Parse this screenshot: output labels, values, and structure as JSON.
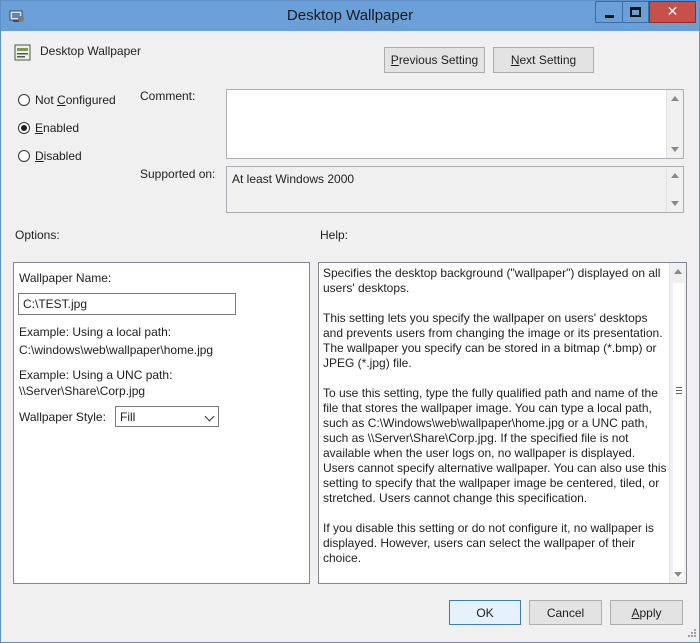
{
  "window": {
    "title": "Desktop Wallpaper",
    "minimize_icon": "minimize-icon",
    "maximize_icon": "maximize-icon",
    "close_icon": "close-icon"
  },
  "header": {
    "policy_name": "Desktop Wallpaper",
    "previous_setting_label": "Previous Setting",
    "previous_setting_mnemonic": "P",
    "next_setting_label": "Next Setting",
    "next_setting_mnemonic": "N"
  },
  "state": {
    "options": [
      {
        "label": "Not Configured",
        "mnemonic": "C",
        "checked": false
      },
      {
        "label": "Enabled",
        "mnemonic": "E",
        "checked": true
      },
      {
        "label": "Disabled",
        "mnemonic": "D",
        "checked": false
      }
    ]
  },
  "comment": {
    "label": "Comment:",
    "value": ""
  },
  "supported": {
    "label": "Supported on:",
    "value": "At least Windows 2000"
  },
  "options_section": {
    "heading": "Options:",
    "wallpaper_name_label": "Wallpaper Name:",
    "wallpaper_name_value": "C:\\TEST.jpg",
    "example_local_label": "Example: Using a local path:",
    "example_local_path": "C:\\windows\\web\\wallpaper\\home.jpg",
    "example_unc_label": "Example: Using a UNC path:",
    "example_unc_path": "\\\\Server\\Share\\Corp.jpg",
    "wallpaper_style_label": "Wallpaper Style:",
    "wallpaper_style_value": "Fill"
  },
  "help_section": {
    "heading": "Help:",
    "paragraphs": [
      "Specifies the desktop background (\"wallpaper\") displayed on all users' desktops.",
      "This setting lets you specify the wallpaper on users' desktops and prevents users from changing the image or its presentation. The wallpaper you specify can be stored in a bitmap (*.bmp) or JPEG (*.jpg) file.",
      "To use this setting, type the fully qualified path and name of the file that stores the wallpaper image. You can type a local path, such as C:\\Windows\\web\\wallpaper\\home.jpg or a UNC path, such as \\\\Server\\Share\\Corp.jpg. If the specified file is not available when the user logs on, no wallpaper is displayed. Users cannot specify alternative wallpaper. You can also use this setting to specify that the wallpaper image be centered, tiled, or stretched. Users cannot change this specification.",
      "If you disable this setting or do not configure it, no wallpaper is displayed. However, users can select the wallpaper of their choice."
    ]
  },
  "footer": {
    "ok_label": "OK",
    "cancel_label": "Cancel",
    "apply_label": "Apply",
    "apply_mnemonic": "A"
  }
}
